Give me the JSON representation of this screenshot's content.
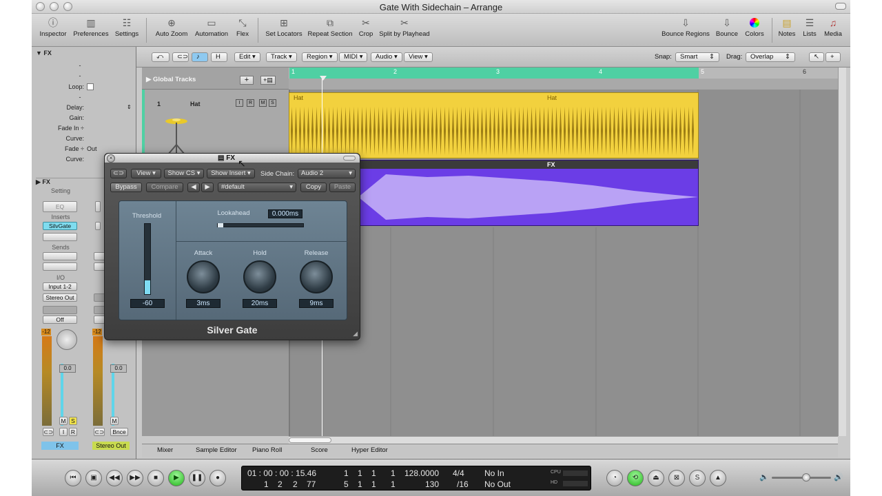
{
  "window": {
    "title": "Gate With Sidechain – Arrange"
  },
  "toolbar": {
    "inspector": "Inspector",
    "preferences": "Preferences",
    "settings": "Settings",
    "auto_zoom": "Auto Zoom",
    "automation": "Automation",
    "flex": "Flex",
    "set_locators": "Set Locators",
    "repeat_section": "Repeat Section",
    "crop": "Crop",
    "split_by_playhead": "Split by Playhead",
    "bounce_regions": "Bounce Regions",
    "bounce": "Bounce",
    "colors": "Colors",
    "notes": "Notes",
    "lists": "Lists",
    "media": "Media"
  },
  "inspector": {
    "header": "FX",
    "dash1": "-",
    "dash2": "-",
    "loop_label": "Loop:",
    "dash3": "-",
    "delay_label": "Delay:",
    "gain_label": "Gain:",
    "fade_in_label": "Fade In ÷",
    "curve1_label": "Curve:",
    "fade_out_label": "Fade ÷",
    "fade_out_value": "Out",
    "curve2_label": "Curve:",
    "fx_section": "FX",
    "setting": "Setting",
    "eq": "EQ",
    "inserts": "Inserts",
    "insert_plugin": "SilvGate",
    "sends": "Sends",
    "io": "I/O",
    "input": "Input 1-2",
    "output": "Stereo Out",
    "automation": "Off",
    "peak1": "-12",
    "peak2": "-12",
    "fader1": "0.0",
    "fader2": "0.0",
    "m": "M",
    "s": "S",
    "i": "I",
    "r": "R",
    "bnce": "Bnce",
    "strip1_name": "FX",
    "strip2_name": "Stereo Out"
  },
  "arrange_menu": {
    "edit": "Edit",
    "track": "Track",
    "region": "Region",
    "midi": "MIDI",
    "audio": "Audio",
    "view": "View",
    "snap_label": "Snap:",
    "snap_value": "Smart",
    "drag_label": "Drag:",
    "drag_value": "Overlap",
    "h_btn": "H"
  },
  "tracklist": {
    "global_tracks": "Global Tracks",
    "track1_number": "1",
    "track1_name": "Hat",
    "i": "I",
    "r": "R",
    "m": "M",
    "s": "S"
  },
  "ruler": {
    "bars": [
      "1",
      "2",
      "3",
      "4",
      "5",
      "6"
    ]
  },
  "regions": {
    "hat_left": "Hat",
    "hat_center": "Hat",
    "fx": "FX"
  },
  "plugin": {
    "title": "FX",
    "view": "View",
    "show_cs": "Show CS",
    "show_insert": "Show Insert",
    "side_chain_label": "Side Chain:",
    "side_chain_value": "Audio 2",
    "bypass": "Bypass",
    "compare": "Compare",
    "preset": "#default",
    "copy": "Copy",
    "paste": "Paste",
    "threshold_label": "Threshold",
    "threshold_value": "-60",
    "threshold_level": 0.2,
    "lookahead_label": "Lookahead",
    "lookahead_value": "0.000ms",
    "attack_label": "Attack",
    "attack_value": "3ms",
    "hold_label": "Hold",
    "hold_value": "20ms",
    "release_label": "Release",
    "release_value": "9ms",
    "name": "Silver Gate"
  },
  "bottom_tabs": [
    "Mixer",
    "Sample Editor",
    "Piano Roll",
    "Score",
    "Hyper Editor"
  ],
  "transport": {
    "smpte": "01 : 00 : 00 : 15.46",
    "bars": [
      "1",
      "1",
      "1",
      "1"
    ],
    "bars2": [
      "1",
      "2",
      "2",
      "77"
    ],
    "locator_left": [
      "1",
      "1",
      "1",
      "1"
    ],
    "locator_right": [
      "5",
      "1",
      "1",
      "1"
    ],
    "tempo": "128.0000",
    "tempo2": "130",
    "sig": "4/4",
    "div": "/16",
    "in": "No In",
    "out": "No Out",
    "cpu": "CPU",
    "hd": "HD"
  },
  "colors": {
    "hat_region": "#f2d13e",
    "fx_region": "#6b3de6",
    "cycle": "#4fd0a3"
  }
}
